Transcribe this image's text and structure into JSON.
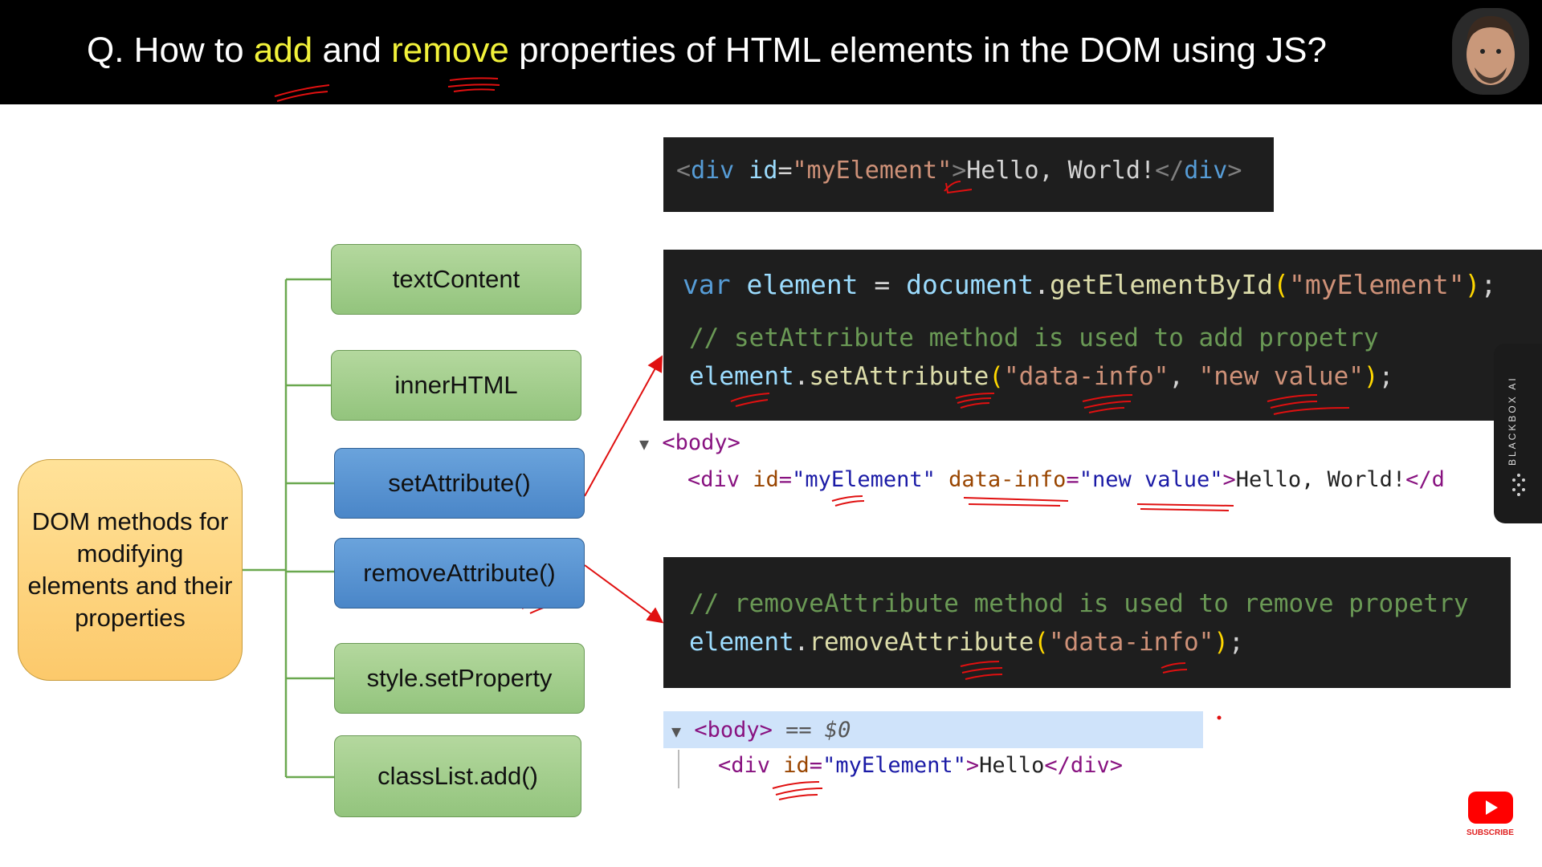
{
  "header": {
    "title_prefix": "Q. How to ",
    "title_add": "add",
    "title_and": " and ",
    "title_remove": "remove",
    "title_suffix": " properties of HTML elements in the DOM using JS?"
  },
  "diagram": {
    "root": "DOM methods for modifying elements and their properties",
    "methods": [
      "textContent",
      "innerHTML",
      "setAttribute()",
      "removeAttribute()",
      "style.setProperty",
      "classList.add()"
    ]
  },
  "code": {
    "html_snippet": {
      "open_lt": "<",
      "tag": "div",
      "attr": " id",
      "eq": "=",
      "val": "\"myElement\"",
      "gt": ">",
      "text": "Hello, World!",
      "close_lt": "</",
      "close_tag": "div",
      "close_gt": ">"
    },
    "js_block": {
      "kw": "var",
      "var": " element",
      "eq": " = ",
      "obj": "document",
      "dot": ".",
      "fn": "getElementById",
      "open": "(",
      "arg": "\"myElement\"",
      "close": ")",
      "semi": ";",
      "comment": "// setAttribute method is used to add propetry",
      "l3_obj": "element",
      "l3_dot": ".",
      "l3_fn": "setAttribute",
      "l3_open": "(",
      "l3_arg1": "\"data-info\"",
      "l3_comma": ", ",
      "l3_arg2": "\"new value\"",
      "l3_close": ")",
      "l3_semi": ";"
    },
    "remove_block": {
      "comment": "// removeAttribute method is used to remove propetry",
      "obj": "element",
      "dot": ".",
      "fn": "removeAttribute",
      "open": "(",
      "arg": "\"data-info\"",
      "close": ")",
      "semi": ";"
    }
  },
  "devtools_after_set": {
    "body_open": "<body>",
    "div_open": "<div ",
    "id_attr": "id",
    "id_eq": "=",
    "id_val": "\"myElement\"",
    "data_attr": "data-info",
    "data_eq": "=",
    "data_val": "\"new value\"",
    "gt": ">",
    "text": "Hello, World!",
    "close": "</d"
  },
  "devtools_after_remove": {
    "body_open": "<body>",
    "selected": "== $0",
    "div_open": "<div ",
    "id_attr": "id",
    "id_eq": "=",
    "id_val": "\"myElement\"",
    "gt": ">",
    "text": "Hello",
    "close": "</div>"
  },
  "sidebar": {
    "label": "BLACKBOX AI"
  },
  "subscribe": {
    "label": "SUBSCRIBE"
  },
  "colors": {
    "highlight": "#f2f23a",
    "annotation": "#e01010",
    "green_node": "#93c47d",
    "blue_node": "#4a86c8",
    "root_node": "#fcc96b"
  }
}
